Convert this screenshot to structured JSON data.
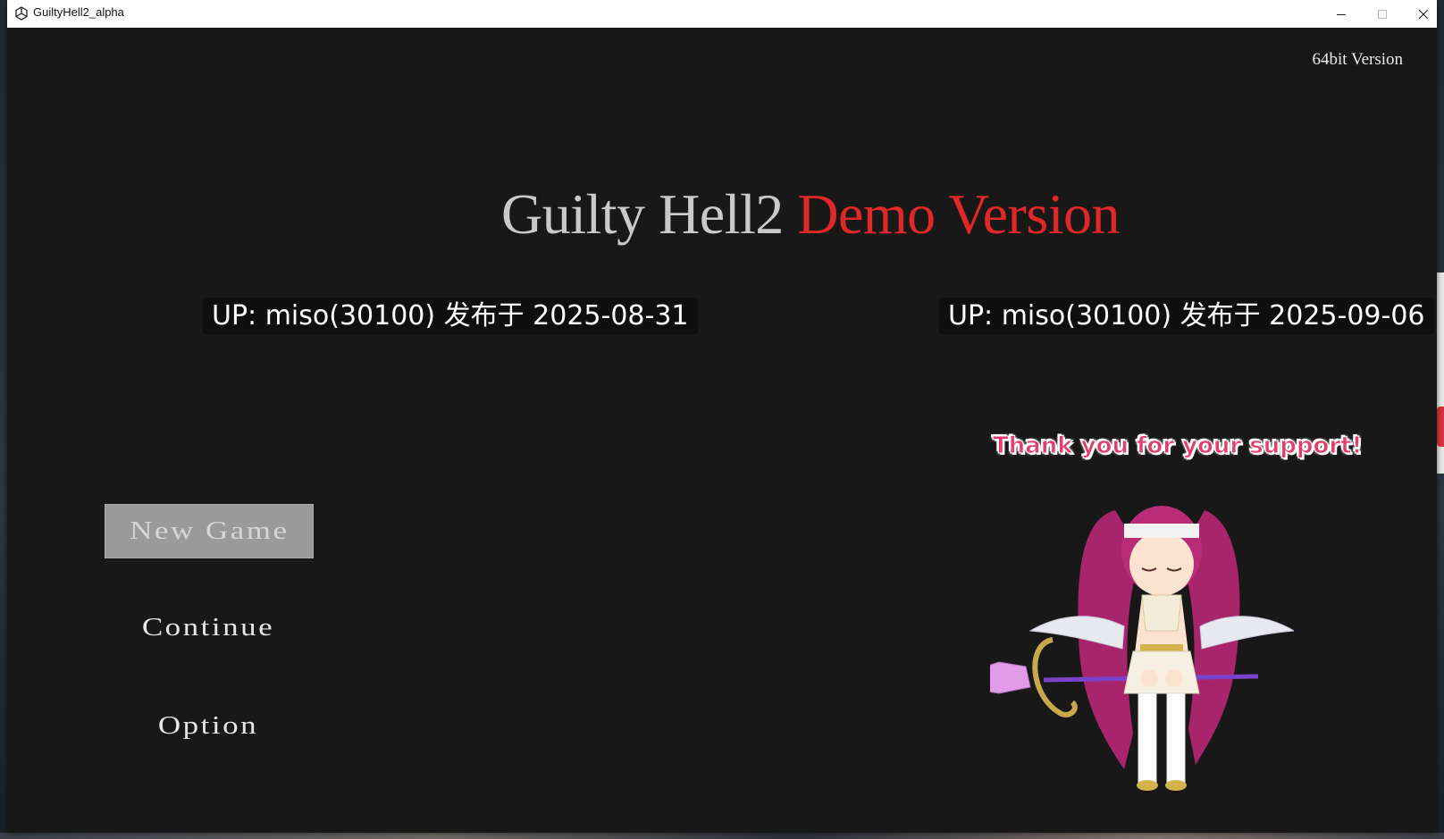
{
  "window": {
    "title": "GuiltyHell2_alpha"
  },
  "game": {
    "version_label": "64bit Version",
    "title_main": "Guilty Hell2",
    "title_accent": "Demo Version",
    "watermarks": [
      "UP: miso(30100) 发布于 2025-08-31",
      "UP: miso(30100) 发布于 2025-09-06"
    ],
    "menu": {
      "items": [
        {
          "label": "New Game",
          "selected": true
        },
        {
          "label": "Continue",
          "selected": false
        },
        {
          "label": "Option",
          "selected": false
        }
      ]
    },
    "support_text": "Thank you for your support!"
  },
  "colors": {
    "background": "#181818",
    "title_main": "#c9c9c9",
    "title_accent": "#e02828",
    "selected_button": "#9a9a9a",
    "support_text": "#e33d6a"
  },
  "icons": {
    "app": "unity-icon",
    "minimize": "minimize-icon",
    "maximize": "maximize-icon",
    "close": "close-icon"
  }
}
